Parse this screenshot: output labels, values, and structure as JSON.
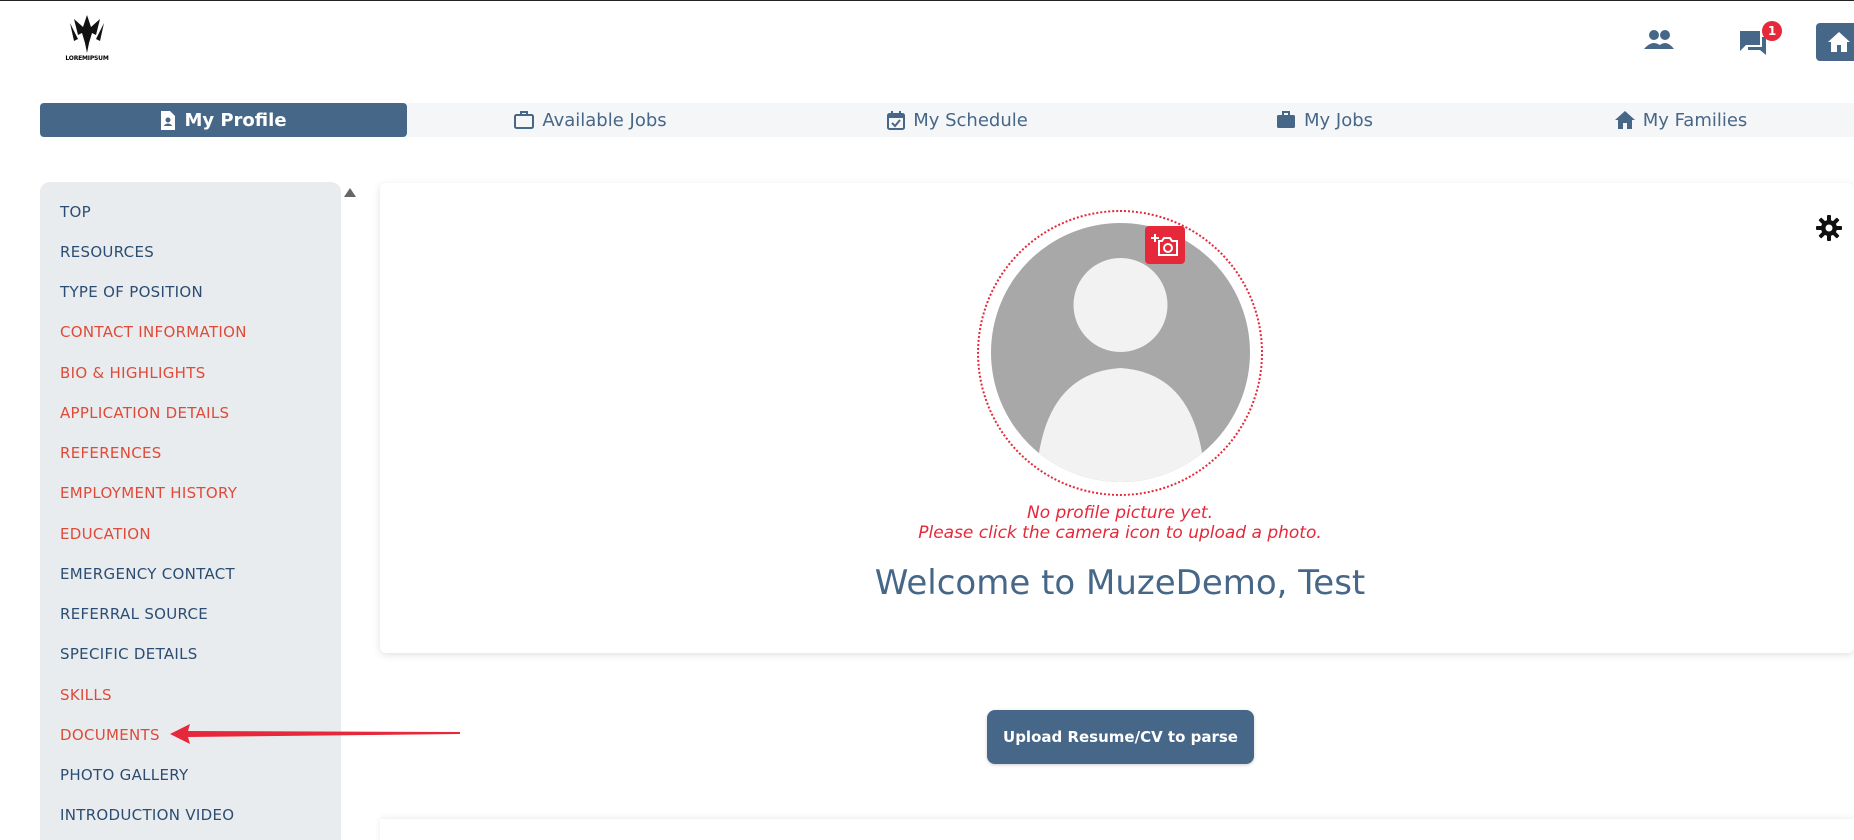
{
  "brand": {
    "logo_caption": "LOREMIPSUM"
  },
  "header": {
    "messages_badge": "1"
  },
  "tabs": [
    {
      "label": "My Profile",
      "active": true,
      "icon": "profile-doc-icon"
    },
    {
      "label": "Available Jobs",
      "active": false,
      "icon": "briefcase-outline-icon"
    },
    {
      "label": "My Schedule",
      "active": false,
      "icon": "calendar-check-icon"
    },
    {
      "label": "My Jobs",
      "active": false,
      "icon": "briefcase-icon"
    },
    {
      "label": "My Families",
      "active": false,
      "icon": "house-icon"
    }
  ],
  "sidebar": {
    "items": [
      {
        "label": "TOP",
        "status": "blue"
      },
      {
        "label": "RESOURCES",
        "status": "blue"
      },
      {
        "label": "TYPE OF POSITION",
        "status": "blue"
      },
      {
        "label": "CONTACT INFORMATION",
        "status": "red"
      },
      {
        "label": "BIO & HIGHLIGHTS",
        "status": "red"
      },
      {
        "label": "APPLICATION DETAILS",
        "status": "red"
      },
      {
        "label": "REFERENCES",
        "status": "red"
      },
      {
        "label": "EMPLOYMENT HISTORY",
        "status": "red"
      },
      {
        "label": "EDUCATION",
        "status": "red"
      },
      {
        "label": "EMERGENCY CONTACT",
        "status": "blue"
      },
      {
        "label": "REFERRAL SOURCE",
        "status": "blue"
      },
      {
        "label": "SPECIFIC DETAILS",
        "status": "blue"
      },
      {
        "label": "SKILLS",
        "status": "red"
      },
      {
        "label": "DOCUMENTS",
        "status": "red"
      },
      {
        "label": "PHOTO GALLERY",
        "status": "blue"
      },
      {
        "label": "INTRODUCTION VIDEO",
        "status": "blue"
      }
    ]
  },
  "profile": {
    "no_picture_line1": "No profile picture yet.",
    "no_picture_line2": "Please click the camera icon to upload a photo.",
    "welcome": "Welcome to MuzeDemo, Test"
  },
  "upload": {
    "label": "Upload Resume/CV to parse"
  },
  "colors": {
    "primary": "#476789",
    "accent_red": "#e5283a",
    "sidebar_bg": "#e9ecef",
    "incomplete_text": "#e04a38",
    "complete_text": "#2b4d73"
  }
}
